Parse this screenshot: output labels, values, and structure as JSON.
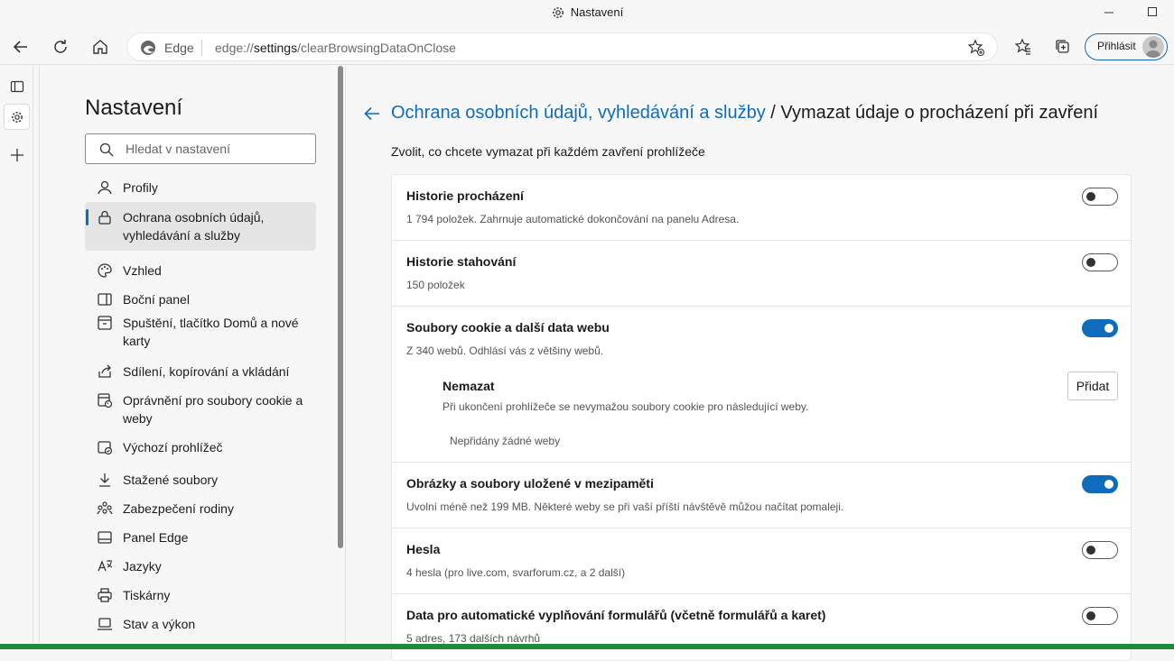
{
  "window": {
    "title": "Nastavení"
  },
  "address": {
    "brand": "Edge",
    "url_prefix": "edge://",
    "url_bold": "settings",
    "url_rest": "/clearBrowsingDataOnClose"
  },
  "toolbar": {
    "login_label": "Přihlásit"
  },
  "sidebar": {
    "title": "Nastavení",
    "search_placeholder": "Hledat v nastavení",
    "items": [
      {
        "label": "Profily",
        "icon": "profile-icon"
      },
      {
        "label": "Ochrana osobních údajů, vyhledávání a služby",
        "icon": "lock-icon",
        "active": true
      },
      {
        "label": "Vzhled",
        "icon": "palette-icon"
      },
      {
        "label": "Boční panel",
        "icon": "sidebar-icon"
      },
      {
        "label": "Spuštění, tlačítko Domů a nové karty",
        "icon": "power-icon"
      },
      {
        "label": "Sdílení, kopírování a vkládání",
        "icon": "share-icon"
      },
      {
        "label": "Oprávnění pro soubory cookie a weby",
        "icon": "cookie-permissions-icon"
      },
      {
        "label": "Výchozí prohlížeč",
        "icon": "browser-icon"
      },
      {
        "label": "Stažené soubory",
        "icon": "download-icon"
      },
      {
        "label": "Zabezpečení rodiny",
        "icon": "family-icon"
      },
      {
        "label": "Panel Edge",
        "icon": "panel-icon"
      },
      {
        "label": "Jazyky",
        "icon": "language-icon"
      },
      {
        "label": "Tiskárny",
        "icon": "printer-icon"
      },
      {
        "label": "Stav a výkon",
        "icon": "laptop-icon"
      }
    ]
  },
  "main": {
    "breadcrumb_link": "Ochrana osobních údajů, vyhledávání a služby",
    "breadcrumb_sep": " / ",
    "page_title": "Vymazat údaje o procházení při zavření",
    "subtitle": "Zvolit, co chcete vymazat při každém zavření prohlížeče",
    "rows": [
      {
        "name": "Historie procházení",
        "desc": "1 794 položek. Zahrnuje automatické dokončování na panelu Adresa.",
        "on": false
      },
      {
        "name": "Historie stahování",
        "desc": "150 položek",
        "on": false
      },
      {
        "name": "Soubory cookie a další data webu",
        "desc": "Z 340 webů. Odhlásí vás z většiny webů.",
        "on": true
      },
      {
        "name": "Obrázky a soubory uložené v mezipaměti",
        "desc": "Uvolní méně než 199 MB. Některé weby se při vaší příští návštěvě můžou načítat pomaleji.",
        "on": true
      },
      {
        "name": "Hesla",
        "desc": "4 hesla (pro live.com, svarforum.cz, a 2 další)",
        "on": false
      },
      {
        "name": "Data pro automatické vyplňování formulářů (včetně formulářů a karet)",
        "desc": "5 adres, 173 dalších návrhů",
        "on": false
      }
    ],
    "exceptions": {
      "title": "Nemazat",
      "desc": "Při ukončení prohlížeče se nevymažou soubory cookie pro následující weby.",
      "add_label": "Přidat",
      "empty": "Nepřidány žádné weby"
    }
  },
  "colors": {
    "accent": "#0f6cbd",
    "taskbar": "#1e8a3a"
  }
}
